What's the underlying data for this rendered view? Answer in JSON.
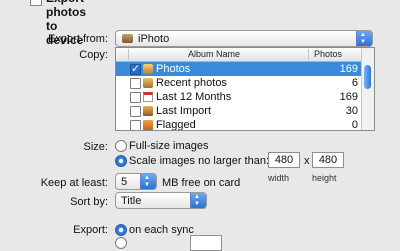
{
  "top": {
    "export_label": "Export photos to device"
  },
  "export_from": {
    "label": "Export from:",
    "value": "iPhoto"
  },
  "copy": {
    "label": "Copy:",
    "headers": {
      "album": "Album Name",
      "photos": "Photos"
    },
    "rows": [
      {
        "name": "Photos",
        "count": "169",
        "checked": true,
        "selected": true,
        "icon": "photos-icon"
      },
      {
        "name": "Recent photos",
        "count": "6",
        "checked": false,
        "selected": false,
        "icon": "album-icon"
      },
      {
        "name": "Last 12 Months",
        "count": "169",
        "checked": false,
        "selected": false,
        "icon": "calendar-icon"
      },
      {
        "name": "Last Import",
        "count": "30",
        "checked": false,
        "selected": false,
        "icon": "import-icon"
      },
      {
        "name": "Flagged",
        "count": "0",
        "checked": false,
        "selected": false,
        "icon": "flag-icon"
      }
    ]
  },
  "size": {
    "label": "Size:",
    "option_full": "Full-size images",
    "option_scale": "Scale images no larger than:",
    "width": "480",
    "height": "480",
    "x": "x",
    "width_caption": "width",
    "height_caption": "height"
  },
  "keep": {
    "label": "Keep at least:",
    "value": "5",
    "suffix": "MB free on card"
  },
  "sort": {
    "label": "Sort by:",
    "value": "Title"
  },
  "export": {
    "label": "Export:",
    "option_each_sync": "on each sync"
  },
  "colors": {
    "selection": "#3b89d9",
    "accent": "#2f78dc",
    "background": "#e8e8e8"
  }
}
